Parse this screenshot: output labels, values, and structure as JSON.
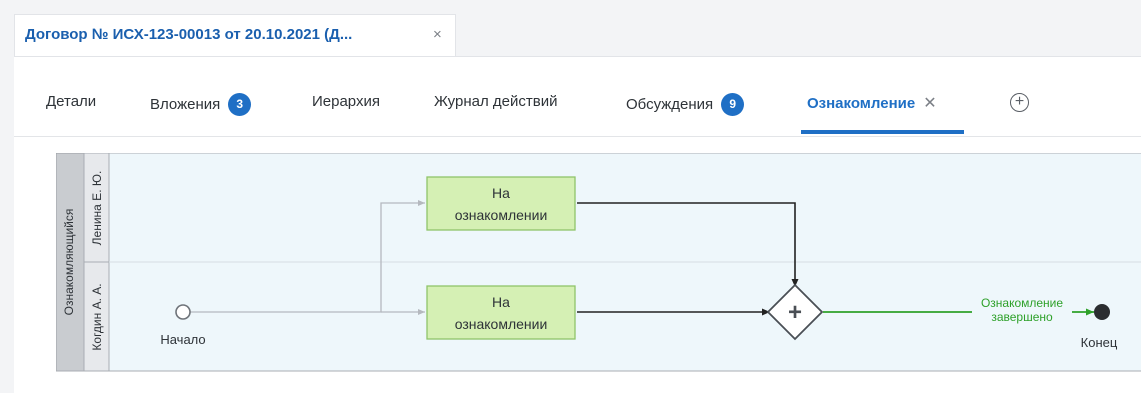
{
  "document_tab": {
    "title": "Договор № ИСХ-123-00013 от 20.10.2021 (Д...",
    "close_glyph": "×"
  },
  "tabs": [
    {
      "label": "Детали"
    },
    {
      "label": "Вложения",
      "badge": "3"
    },
    {
      "label": "Иерархия"
    },
    {
      "label": "Журнал действий"
    },
    {
      "label": "Обсуждения",
      "badge": "9"
    },
    {
      "label": "Ознакомление",
      "active": true,
      "close_glyph": "✕"
    }
  ],
  "add_tab_glyph": "+",
  "diagram": {
    "pool_label": "Ознакомляющийся",
    "lanes": [
      {
        "label": "Ленина Е. Ю."
      },
      {
        "label": "Когдин А. А."
      }
    ],
    "tasks": [
      {
        "line1": "На",
        "line2": "ознакомлении"
      },
      {
        "line1": "На",
        "line2": "ознакомлении"
      }
    ],
    "start_label": "Начало",
    "end_label": "Конец",
    "gateway_glyph": "+",
    "flow_label_line1": "Ознакомление",
    "flow_label_line2": "завершено",
    "colors": {
      "lane_bg": "#eef7fb",
      "task_fill": "#d5f0b4",
      "task_stroke": "#8fc46a",
      "completed_flow": "#2ea12a",
      "accent": "#1f6fc5"
    }
  }
}
